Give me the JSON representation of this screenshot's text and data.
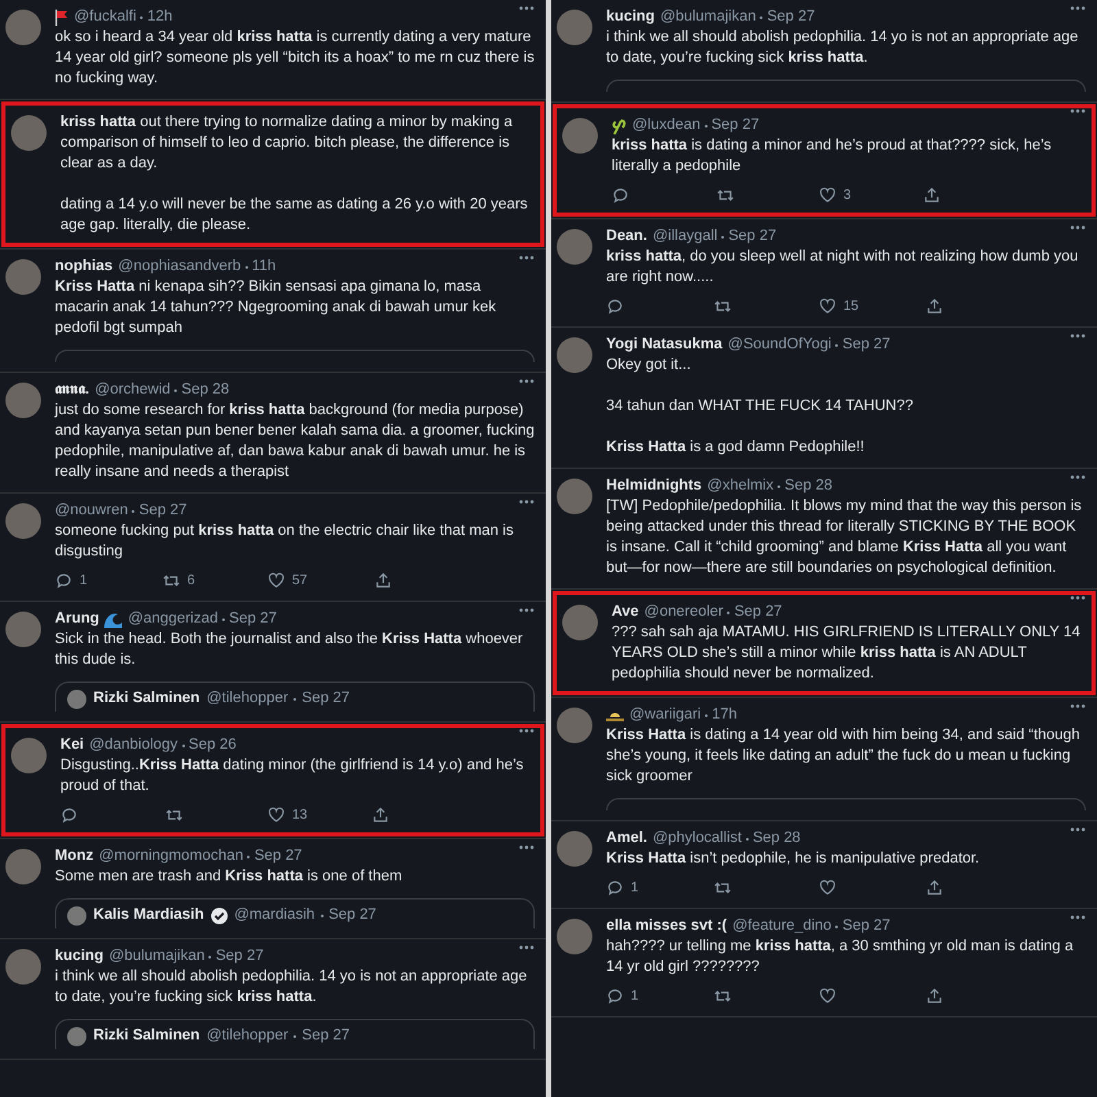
{
  "columns": [
    {
      "tweets": [
        {
          "badge": {
            "kind": "flag"
          },
          "handle": "@fuckalfi",
          "date": "12h",
          "body": "ok so i heard a 34 year old **kriss hatta** is currently dating a very mature 14 year old girl? someone pls yell “bitch its a hoax” to me rn cuz there is no fucking way.",
          "highlighted": false
        },
        {
          "body": "**kriss hatta** out there trying to normalize dating a minor by making a comparison of himself to leo d caprio. bitch please, the difference is clear as a day.\n\ndating a 14 y.o will never be the same as dating a 26 y.o with 20 years age gap. literally, die please.",
          "highlighted": true
        },
        {
          "name": "nophias",
          "handle": "@nophiasandverb",
          "date": "11h",
          "body": "**Kriss Hatta** ni kenapa sih?? Bikin sensasi apa gimana lo, masa macarin anak 14 tahun??? Ngegrooming anak di bawah umur kek pedofil bgt sumpah",
          "highlighted": false,
          "quote_stub": true
        },
        {
          "name": "𝖆𝖓𝖓𝖆.",
          "handle": "@orchewid",
          "date": "Sep 28",
          "body": "just do some research for **kriss hatta** background (for media purpose) and kayanya setan pun bener bener kalah sama dia. a groomer, fucking pedophile, manipulative af, dan bawa kabur anak di bawah umur. he is really insane and needs a therapist",
          "highlighted": false
        },
        {
          "handle": "@nouwren",
          "date": "Sep 27",
          "body": "someone fucking put **kriss hatta** on the electric chair like that man is disgusting",
          "highlighted": false,
          "actions": true,
          "reply_count": "1",
          "retweet_count": "6",
          "like_count": "57"
        },
        {
          "name": "Arung",
          "badge": {
            "kind": "wave"
          },
          "handle": "@anggerizad",
          "date": "Sep 27",
          "body": "Sick in the head. Both the journalist and also the **Kriss Hatta** whoever this dude is.",
          "highlighted": false,
          "quote": {
            "name": "Rizki Salminen",
            "handle": "@tilehopper",
            "date": "Sep 27",
            "verified": false
          }
        },
        {
          "name": "Kei",
          "handle": "@danbiology",
          "date": "Sep 26",
          "body": "Disgusting..**Kriss Hatta** dating minor (the girlfriend is 14 y.o) and he’s proud of that.",
          "highlighted": true,
          "actions": true,
          "like_count": "13"
        },
        {
          "name": "Monz",
          "handle": "@morningmomochan",
          "date": "Sep 27",
          "body": "Some men are trash and **Kriss hatta** is one of them",
          "highlighted": false,
          "quote": {
            "name": "Kalis Mardiasih",
            "handle": "@mardiasih",
            "date": "Sep 27",
            "verified": true
          }
        },
        {
          "name": "kucing",
          "handle": "@bulumajikan",
          "date": "Sep 27",
          "body": "i think we all should abolish pedophilia. 14 yo is not an appropriate age to date, you’re fucking sick **kriss hatta**.",
          "highlighted": false,
          "quote": {
            "name": "Rizki Salminen",
            "handle": "@tilehopper",
            "date": "Sep 27",
            "verified": false
          }
        }
      ]
    },
    {
      "tweets": [
        {
          "name": "kucing",
          "handle": "@bulumajikan",
          "date": "Sep 27",
          "body": "i think we all should abolish pedophilia. 14 yo is not an appropriate age to date, you’re fucking sick **kriss hatta**.",
          "highlighted": false,
          "quote_stub": true
        },
        {
          "badge": {
            "kind": "plant"
          },
          "handle": "@luxdean",
          "date": "Sep 27",
          "body": "**kriss hatta** is dating a minor and he’s proud at that???? sick, he’s literally a pedophile",
          "highlighted": true,
          "actions": true,
          "like_count": "3"
        },
        {
          "name": "Dean.",
          "handle": "@illaygall",
          "date": "Sep 27",
          "body": "**kriss hatta**, do you sleep well at night with not realizing how dumb you are right now.....",
          "highlighted": false,
          "actions": true,
          "like_count": "15"
        },
        {
          "name": "Yogi Natasukma",
          "handle": "@SoundOfYogi",
          "date": "Sep 27",
          "body": "Okey got it...\n\n34 tahun dan WHAT THE FUCK 14 TAHUN??\n\n**Kriss Hatta** is a god damn Pedophile!!",
          "highlighted": false
        },
        {
          "name": "Helmidnights",
          "handle": "@xhelmix",
          "date": "Sep 28",
          "body": "[TW] Pedophile/pedophilia. It blows my mind that the way this person is being attacked under this thread for literally STICKING BY THE BOOK is insane. Call it “child grooming” and blame **Kriss Hatta** all you want but—for now—there are still boundaries on psychological definition.",
          "highlighted": false
        },
        {
          "name": "Ave",
          "handle": "@onereoler",
          "date": "Sep 27",
          "body": "??? sah sah aja MATAMU. HIS GIRLFRIEND IS LITERALLY ONLY 14 YEARS OLD she’s still a minor while **kriss hatta** is AN ADULT pedophilia should never be normalized.",
          "highlighted": true
        },
        {
          "badge": {
            "kind": "hat"
          },
          "handle": "@wariigari",
          "date": "17h",
          "body": "**Kriss Hatta** is dating a 14 year old with him being 34, and said “though she’s young, it feels like dating an adult” the fuck do u mean u fucking sick groomer",
          "highlighted": false,
          "quote_stub": true
        },
        {
          "name": "Amel.",
          "handle": "@phylocallist",
          "date": "Sep 28",
          "body": "**Kriss Hatta** isn’t pedophile, he is manipulative predator.",
          "highlighted": false,
          "actions": true,
          "reply_count": "1"
        },
        {
          "name": "ella misses svt :(",
          "handle": "@feature_dino",
          "date": "Sep 27",
          "body": "hah???? ur telling me **kriss hatta**, a 30 smthing yr old man is dating a 14 yr old girl ????????",
          "highlighted": false,
          "actions": true,
          "reply_count": "1"
        }
      ]
    }
  ]
}
